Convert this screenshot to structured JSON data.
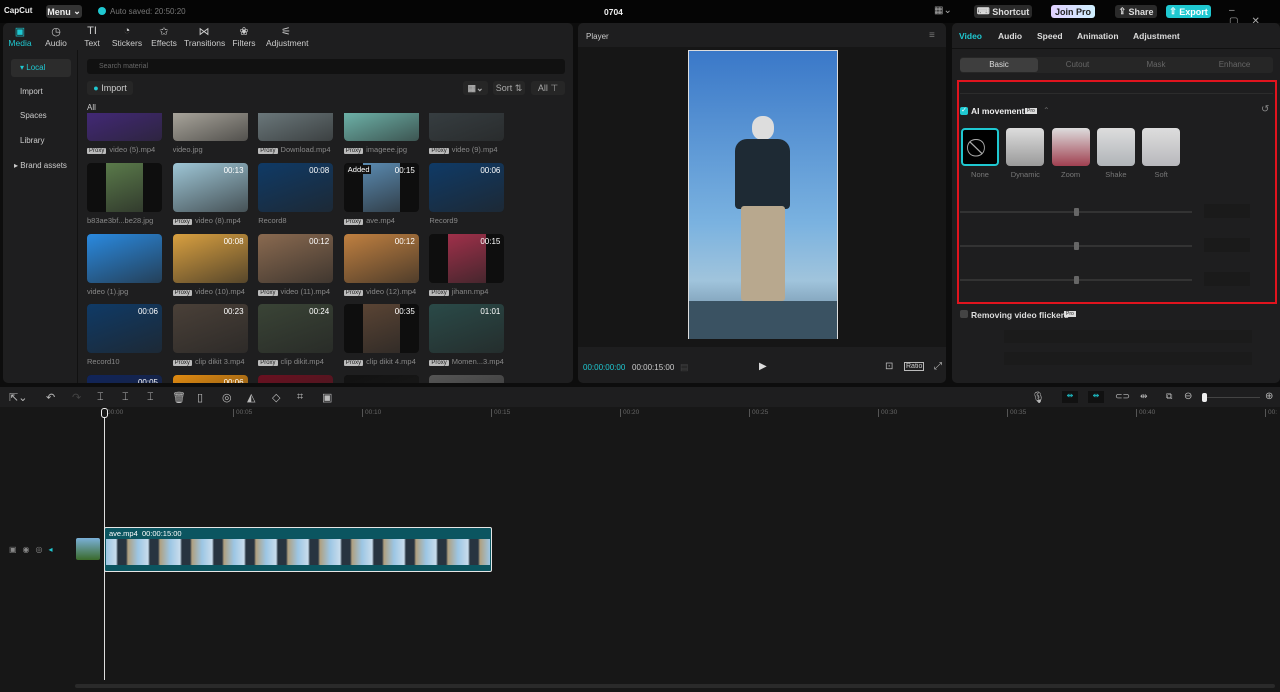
{
  "app": {
    "logo": "CapCut",
    "menu": "Menu",
    "autosave": "Auto saved: 20:50:20",
    "project": "0704",
    "shortcut": "Shortcut",
    "join_pro": "Join Pro",
    "share": "Share",
    "export": "Export"
  },
  "tabs": [
    {
      "icon": "▣",
      "label": "Media"
    },
    {
      "icon": "◷",
      "label": "Audio"
    },
    {
      "icon": "TI",
      "label": "Text"
    },
    {
      "icon": "◔",
      "label": "Stickers"
    },
    {
      "icon": "✩",
      "label": "Effects"
    },
    {
      "icon": "⋈",
      "label": "Transitions"
    },
    {
      "icon": "❀",
      "label": "Filters"
    },
    {
      "icon": "⚟",
      "label": "Adjustment"
    }
  ],
  "sidebar": [
    "▾ Local",
    "Import",
    "Spaces",
    "Library",
    "▸ Brand assets"
  ],
  "media": {
    "search_placeholder": "Search material",
    "import": "Import",
    "sort": "Sort",
    "all": "All",
    "section": "All",
    "proxy": "Proxy",
    "added": "Added",
    "items": [
      {
        "name": "video (5).mp4",
        "proxy": true,
        "dur": "",
        "c": "#4a2a8a"
      },
      {
        "name": "video.jpg",
        "proxy": false,
        "dur": "",
        "c": "#c9c4b8"
      },
      {
        "name": "Download.mp4",
        "proxy": true,
        "dur": "",
        "c": "#7c8c90"
      },
      {
        "name": "imageee.jpg",
        "proxy": true,
        "dur": "",
        "c": "#7fd4c8"
      },
      {
        "name": "video (9).mp4",
        "proxy": true,
        "dur": "",
        "c": "#3b4448"
      },
      {
        "name": "b83ae3bf...be28.jpg",
        "proxy": false,
        "dur": "",
        "c": "#5a7a4a"
      },
      {
        "name": "video (8).mp4",
        "proxy": true,
        "dur": "00:13",
        "c": "#9ec6d6"
      },
      {
        "name": "Record8",
        "proxy": false,
        "dur": "00:08",
        "c": "#0f3a66"
      },
      {
        "name": "ave.mp4",
        "proxy": true,
        "dur": "00:15",
        "c": "#5a8ab0",
        "added": true
      },
      {
        "name": "Record9",
        "proxy": false,
        "dur": "00:06",
        "c": "#0f3a66"
      },
      {
        "name": "video (1).jpg",
        "proxy": false,
        "dur": "",
        "c": "#2a8ae0"
      },
      {
        "name": "video (10).mp4",
        "proxy": true,
        "dur": "00:08",
        "c": "#d9a040"
      },
      {
        "name": "video (11).mp4",
        "proxy": true,
        "dur": "00:12",
        "c": "#8a6a50"
      },
      {
        "name": "video (12).mp4",
        "proxy": true,
        "dur": "00:12",
        "c": "#c08040"
      },
      {
        "name": "jihann.mp4",
        "proxy": true,
        "dur": "00:15",
        "c": "#a0304a"
      },
      {
        "name": "Record10",
        "proxy": false,
        "dur": "00:06",
        "c": "#0f3a66"
      },
      {
        "name": "clip dikit 3.mp4",
        "proxy": true,
        "dur": "00:23",
        "c": "#4a4038"
      },
      {
        "name": "clip dikit.mp4",
        "proxy": true,
        "dur": "00:24",
        "c": "#3a4436"
      },
      {
        "name": "clip dikit 4.mp4",
        "proxy": true,
        "dur": "00:35",
        "c": "#5a4434"
      },
      {
        "name": "Momen...3.mp4",
        "proxy": true,
        "dur": "01:01",
        "c": "#2a4a48"
      },
      {
        "name": "",
        "proxy": false,
        "dur": "00:05",
        "c": "#10245a"
      },
      {
        "name": "",
        "proxy": false,
        "dur": "00:06",
        "c": "#e08a10"
      },
      {
        "name": "",
        "proxy": false,
        "dur": "",
        "c": "#6a1020"
      },
      {
        "name": "",
        "proxy": false,
        "dur": "",
        "c": "#111"
      },
      {
        "name": "",
        "proxy": false,
        "dur": "",
        "c": "#555"
      }
    ]
  },
  "player": {
    "title": "Player",
    "current": "00:00:00:00",
    "total": "00:00:15:00",
    "ratio": "Ratio"
  },
  "right": {
    "tabs": [
      "Video",
      "Audio",
      "Speed",
      "Animation",
      "Adjustment"
    ],
    "subtabs": [
      "Basic",
      "Cutout",
      "Mask",
      "Enhance"
    ],
    "ai_movement": "AI movement",
    "pro": "Pro",
    "presets": [
      {
        "label": "None",
        "c": "#000"
      },
      {
        "label": "Dynamic",
        "c": "#9a9a9a"
      },
      {
        "label": "Zoom",
        "c": "#a04050"
      },
      {
        "label": "Shake",
        "c": "#b0b4b8"
      },
      {
        "label": "Soft",
        "c": "#b8b8bc"
      }
    ],
    "flicker": "Removing video flickers"
  },
  "timeline": {
    "ticks": [
      "00:00",
      "00:05",
      "00:10",
      "00:15",
      "00:20",
      "00:25",
      "00:30",
      "00:35",
      "00:40",
      "00:"
    ],
    "clip_name": "ave.mp4",
    "clip_dur": "00:00:15:00"
  },
  "colors": {
    "accent": "#1fc8d1",
    "highlight": "#e0141e"
  }
}
